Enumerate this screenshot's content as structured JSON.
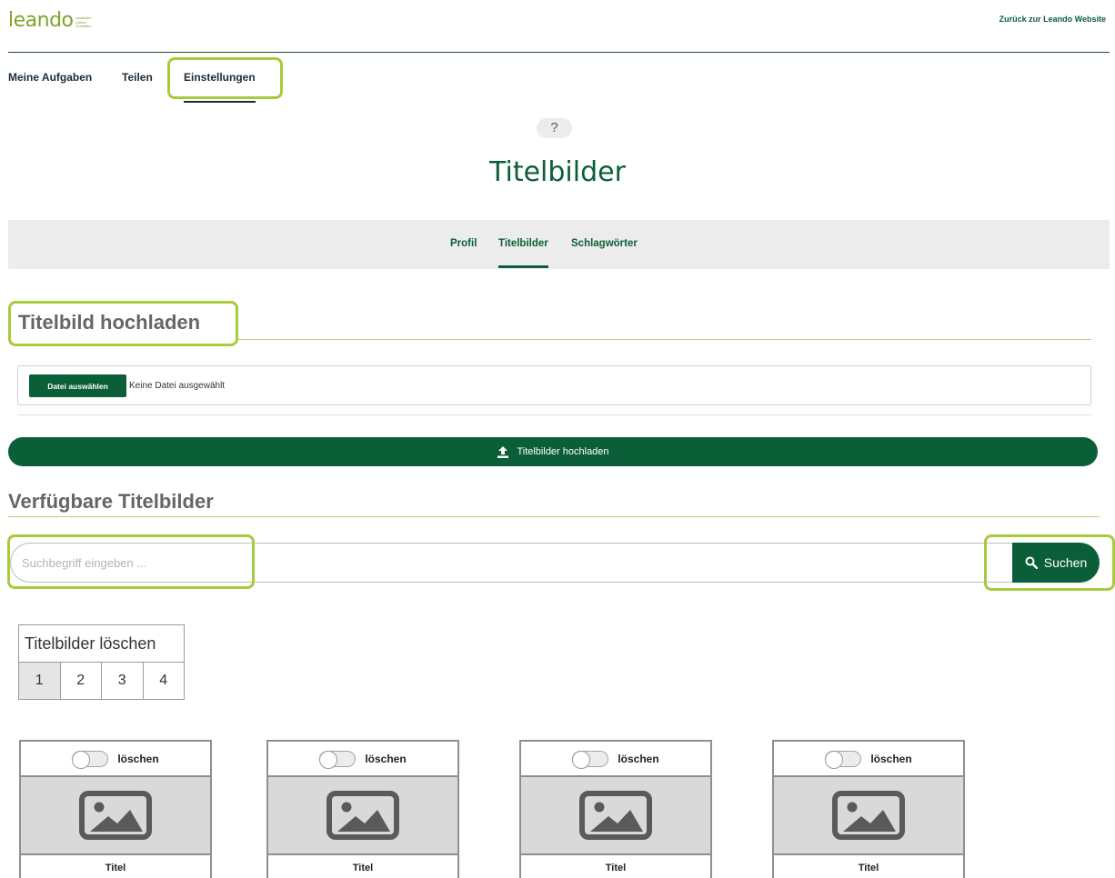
{
  "header": {
    "logo_word": "leando",
    "logo_tagline": [
      "ausbilden",
      "prüfen",
      "verwalten"
    ],
    "back_link": "Zurück zur Leando Website"
  },
  "main_tabs": [
    {
      "label": "Meine Aufgaben",
      "active": false
    },
    {
      "label": "Teilen",
      "active": false
    },
    {
      "label": "Einstellungen",
      "active": true
    }
  ],
  "help_label": "?",
  "page_title": "Titelbilder",
  "sub_tabs": [
    {
      "label": "Profil",
      "active": false
    },
    {
      "label": "Titelbilder",
      "active": true
    },
    {
      "label": "Schlagwörter",
      "active": false
    }
  ],
  "upload_section": {
    "title": "Titelbild hochladen",
    "file_button": "Datei auswählen",
    "file_status": "Keine Datei ausgewählt",
    "upload_button": "Titelbilder hochladen"
  },
  "available_section": {
    "title": "Verfügbare Titelbilder",
    "search_placeholder": "Suchbegriff eingeben ...",
    "search_button": "Suchen"
  },
  "delete_table": {
    "header": "Titelbilder löschen",
    "pages": [
      "1",
      "2",
      "3",
      "4"
    ],
    "active_page": "1"
  },
  "cards": [
    {
      "toggle_label": "löschen",
      "title": "Titel"
    },
    {
      "toggle_label": "löschen",
      "title": "Titel"
    },
    {
      "toggle_label": "löschen",
      "title": "Titel"
    },
    {
      "toggle_label": "löschen",
      "title": "Titel"
    }
  ],
  "colors": {
    "brand_green": "#0b5f38",
    "accent_lime": "#a7cb3d",
    "logo_green": "#7da42b"
  }
}
